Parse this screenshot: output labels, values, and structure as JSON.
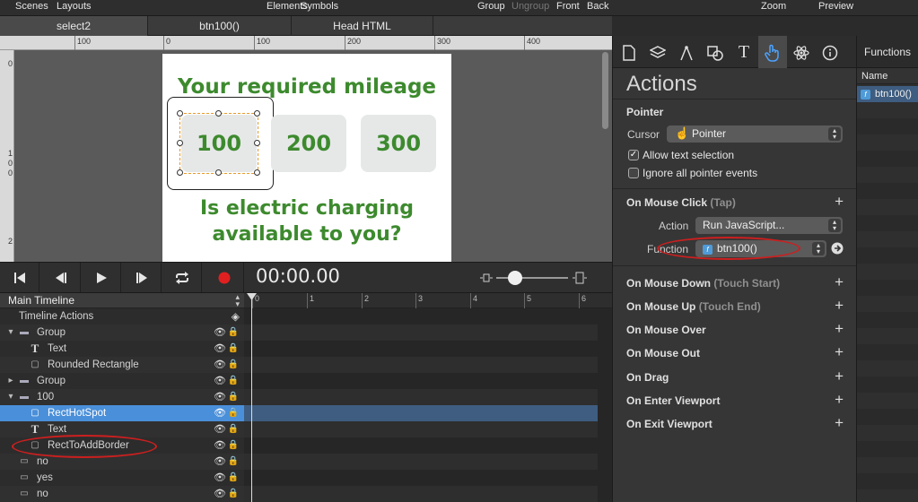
{
  "toolbar": {
    "scenes": "Scenes",
    "layouts": "Layouts",
    "elements": "Elements",
    "symbols": "Symbols",
    "group": "Group",
    "ungroup": "Ungroup",
    "front": "Front",
    "back": "Back",
    "zoom": "Zoom",
    "preview": "Preview"
  },
  "tabs": [
    "select2",
    "btn100()",
    "Head HTML"
  ],
  "ruler": {
    "h": [
      "100",
      "0",
      "100",
      "200",
      "300",
      "400"
    ],
    "v": [
      "0",
      "1\n0\n0",
      "2"
    ]
  },
  "stage": {
    "title": "Your required mileage",
    "buttons": [
      "100",
      "200",
      "300"
    ],
    "question_line1": "Is electric charging",
    "question_line2": "available to you?"
  },
  "playback": {
    "timecode": "00:00.00"
  },
  "timeline": {
    "name": "Main Timeline",
    "ticks": [
      "0",
      "1",
      "2",
      "3",
      "4",
      "5",
      "6"
    ],
    "layers": [
      {
        "label": "Timeline Actions",
        "icon": "none",
        "indent": 0
      },
      {
        "label": "Group",
        "icon": "folder-icon",
        "indent": 0
      },
      {
        "label": "Text",
        "icon": "text-icon",
        "indent": 1
      },
      {
        "label": "Rounded Rectangle",
        "icon": "rect-icon",
        "indent": 1
      },
      {
        "label": "Group",
        "icon": "folder-icon",
        "indent": 0
      },
      {
        "label": "100",
        "icon": "folder-icon",
        "indent": 0
      },
      {
        "label": "RectHotSpot",
        "icon": "rect-icon",
        "indent": 1
      },
      {
        "label": "Text",
        "icon": "text-icon",
        "indent": 1
      },
      {
        "label": "RectToAddBorder",
        "icon": "rect-icon",
        "indent": 1
      },
      {
        "label": "no",
        "icon": "rect-icon",
        "indent": 0
      },
      {
        "label": "yes",
        "icon": "rect-icon",
        "indent": 0
      },
      {
        "label": "no",
        "icon": "rect-icon",
        "indent": 0
      }
    ]
  },
  "inspector": {
    "title": "Actions",
    "pointer": {
      "heading": "Pointer",
      "cursor_label": "Cursor",
      "cursor_value": "Pointer",
      "allow_text": "Allow text selection",
      "ignore_events": "Ignore all pointer events"
    },
    "mouse_click": {
      "heading": "On Mouse Click",
      "sub": "(Tap)",
      "action_label": "Action",
      "action_value": "Run JavaScript...",
      "function_label": "Function",
      "function_value": "btn100()"
    },
    "events": [
      {
        "label": "On Mouse Down",
        "sub": "(Touch Start)"
      },
      {
        "label": "On Mouse Up",
        "sub": "(Touch End)"
      },
      {
        "label": "On Mouse Over",
        "sub": ""
      },
      {
        "label": "On Mouse Out",
        "sub": ""
      },
      {
        "label": "On Drag",
        "sub": ""
      },
      {
        "label": "On Enter Viewport",
        "sub": ""
      },
      {
        "label": "On Exit Viewport",
        "sub": ""
      }
    ]
  },
  "functions": {
    "title": "Functions",
    "column": "Name",
    "items": [
      "btn100()"
    ]
  },
  "colors": {
    "accent_green": "#3d8a2e",
    "selection_blue": "#4a8fd9",
    "annotation_red": "#cc1f1f",
    "record_red": "#e02020"
  }
}
